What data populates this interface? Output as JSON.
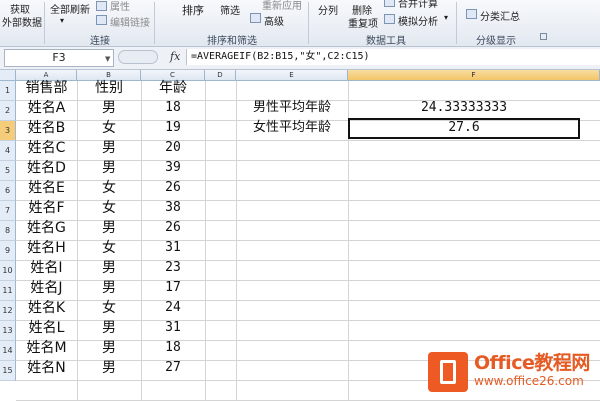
{
  "ribbon": {
    "get_external": [
      "获取",
      "外部数据"
    ],
    "refresh_all": "全部刷新",
    "properties": "属性",
    "edit_links": "编辑链接",
    "sort": "排序",
    "filter": "筛选",
    "reapply": "重新应用",
    "advanced": "高级",
    "text_to_columns": "分列",
    "remove_duplicates": [
      "删除",
      "重复项"
    ],
    "consolidate": "合并计算",
    "what_if": "模拟分析",
    "subtotal": "分类汇总",
    "groups": {
      "connections": "连接",
      "sort_filter": "排序和筛选",
      "data_tools": "数据工具",
      "outline": "分级显示"
    }
  },
  "formula_bar": {
    "name_box": "F3",
    "fx": "fx",
    "formula": "=AVERAGEIF(B2:B15,\"女\",C2:C15)"
  },
  "columns": [
    "A",
    "B",
    "C",
    "D",
    "E",
    "F"
  ],
  "rows": [
    "1",
    "2",
    "3",
    "4",
    "5",
    "6",
    "7",
    "8",
    "9",
    "10",
    "11",
    "12",
    "13",
    "14",
    "15"
  ],
  "table": {
    "headers": [
      "销售部",
      "性别",
      "年龄"
    ],
    "data": [
      [
        "姓名A",
        "男",
        "18"
      ],
      [
        "姓名B",
        "女",
        "19"
      ],
      [
        "姓名C",
        "男",
        "20"
      ],
      [
        "姓名D",
        "男",
        "39"
      ],
      [
        "姓名E",
        "女",
        "26"
      ],
      [
        "姓名F",
        "女",
        "38"
      ],
      [
        "姓名G",
        "男",
        "26"
      ],
      [
        "姓名H",
        "女",
        "31"
      ],
      [
        "姓名I",
        "男",
        "23"
      ],
      [
        "姓名J",
        "男",
        "17"
      ],
      [
        "姓名K",
        "女",
        "24"
      ],
      [
        "姓名L",
        "男",
        "31"
      ],
      [
        "姓名M",
        "男",
        "18"
      ],
      [
        "姓名N",
        "男",
        "27"
      ]
    ]
  },
  "summary": {
    "male_label": "男性平均年龄",
    "male_value": "24.33333333",
    "female_label": "女性平均年龄",
    "female_value": "27.6"
  },
  "selection": {
    "active_column": "F",
    "active_row": "3"
  },
  "watermark": {
    "brand": "Office教程网",
    "url": "www.office26.com"
  },
  "colors": {
    "accent_orange": "#e65b24",
    "header_selected": "#f5cd7a"
  }
}
